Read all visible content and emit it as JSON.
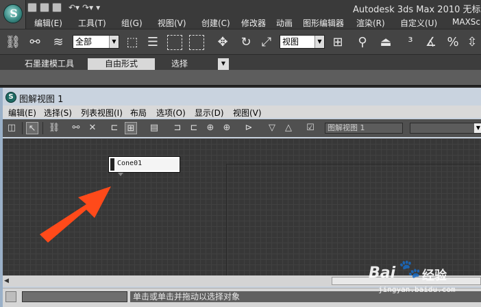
{
  "titlebar": {
    "title": "Autodesk 3ds Max  2010    无标"
  },
  "menubar": {
    "items": [
      "编辑(E)",
      "工具(T)",
      "组(G)",
      "视图(V)",
      "创建(C)",
      "修改器",
      "动画",
      "图形编辑器",
      "渲染(R)",
      "自定义(U)",
      "MAXSc"
    ]
  },
  "maintoolbar": {
    "selection_filter": "全部",
    "reference_coord": "视图"
  },
  "ribbon": {
    "tabs": [
      "石墨建模工具",
      "自由形式",
      "选择"
    ],
    "active_tab": "自由形式"
  },
  "schematic": {
    "window_title": "图解视图 1",
    "menu": [
      "编辑(E)",
      "选择(S)",
      "列表视图(I)",
      "布局",
      "选项(O)",
      "显示(D)",
      "视图(V)"
    ],
    "view_name": "图解视图 1",
    "node": {
      "label": "Cone01"
    }
  },
  "status": {
    "prompt": "单击或单击并拖动以选择对象"
  },
  "watermark": {
    "brand": "Bai",
    "brand_suffix": "经验",
    "url": "jingyan.baidu.com"
  },
  "colors": {
    "annotation_arrow": "#ff4a1a",
    "canvas_bg": "#373737",
    "grid_line": "#414141"
  }
}
